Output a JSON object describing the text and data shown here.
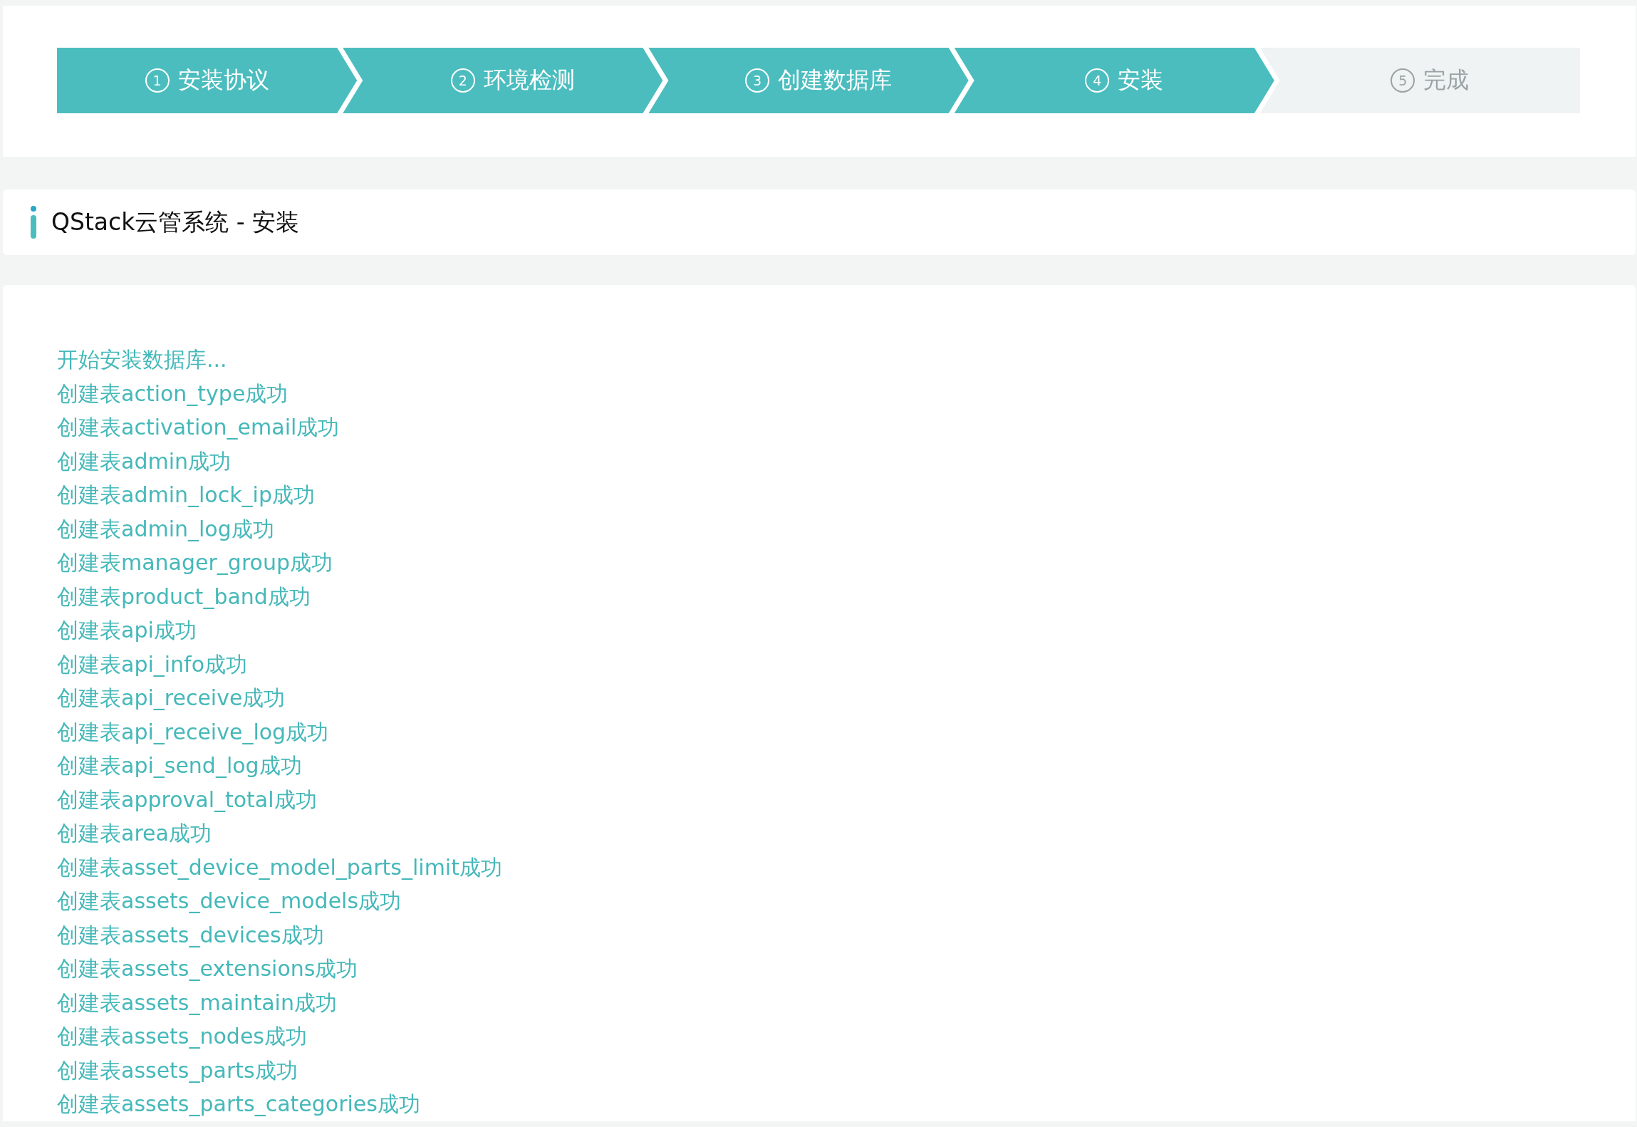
{
  "steps": [
    {
      "number": "1",
      "label": "安装协议",
      "done": true
    },
    {
      "number": "2",
      "label": "环境检测",
      "done": true
    },
    {
      "number": "3",
      "label": "创建数据库",
      "done": true
    },
    {
      "number": "4",
      "label": "安装",
      "done": true
    },
    {
      "number": "5",
      "label": "完成",
      "done": false
    }
  ],
  "header": {
    "title": "QStack云管系统 - 安装"
  },
  "log_lines": [
    "开始安装数据库...",
    "创建表action_type成功",
    "创建表activation_email成功",
    "创建表admin成功",
    "创建表admin_lock_ip成功",
    "创建表admin_log成功",
    "创建表manager_group成功",
    "创建表product_band成功",
    "创建表api成功",
    "创建表api_info成功",
    "创建表api_receive成功",
    "创建表api_receive_log成功",
    "创建表api_send_log成功",
    "创建表approval_total成功",
    "创建表area成功",
    "创建表asset_device_model_parts_limit成功",
    "创建表assets_device_models成功",
    "创建表assets_devices成功",
    "创建表assets_extensions成功",
    "创建表assets_maintain成功",
    "创建表assets_nodes成功",
    "创建表assets_parts成功",
    "创建表assets_parts_categories成功"
  ]
}
